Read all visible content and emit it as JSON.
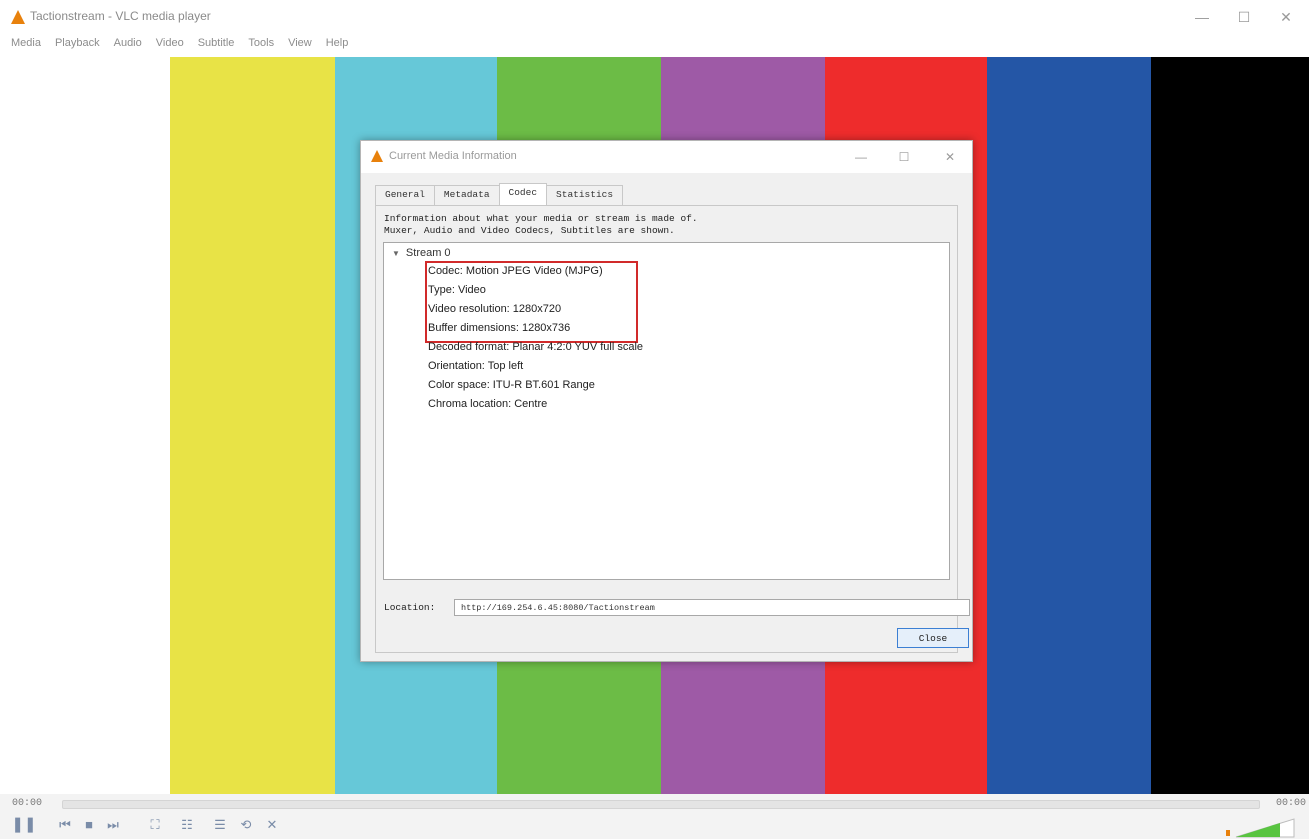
{
  "window": {
    "title": "Tactionstream - VLC media player",
    "minimize": "—",
    "maximize": "☐",
    "close": "✕"
  },
  "menubar": [
    "Media",
    "Playback",
    "Audio",
    "Video",
    "Subtitle",
    "Tools",
    "View",
    "Help"
  ],
  "video": {
    "bars": [
      "#e8e346",
      "#66c8d8",
      "#6cbc46",
      "#9e5aa6",
      "#ee2c2c",
      "#2456a6",
      "#000000"
    ]
  },
  "dialog": {
    "title": "Current Media Information",
    "minimize": "—",
    "maximize": "☐",
    "close": "✕",
    "tabs": [
      "General",
      "Metadata",
      "Codec",
      "Statistics"
    ],
    "active_tab": "Codec",
    "description_line1": "Information about what your media or stream is made of.",
    "description_line2": "Muxer, Audio and Video Codecs, Subtitles are shown.",
    "stream_label": "Stream 0",
    "stream_items": [
      "Codec: Motion JPEG Video (MJPG)",
      "Type: Video",
      "Video resolution: 1280x720",
      "Buffer dimensions: 1280x736",
      "Decoded format: Planar 4:2:0 YUV full scale",
      "Orientation: Top left",
      "Color space: ITU-R BT.601 Range",
      "Chroma location: Centre"
    ],
    "location_label": "Location:",
    "location_value": "http://169.254.6.45:8080/Tactionstream",
    "close_button": "Close"
  },
  "controls": {
    "time_elapsed": "00:00",
    "time_total": "00:00",
    "play_pause": "❚❚",
    "prev": "⏮",
    "stop": "■",
    "next": "⏭",
    "fullscreen": "⛶",
    "extended": "☷",
    "playlist": "☰",
    "loop": "⟲",
    "shuffle": "✕"
  }
}
